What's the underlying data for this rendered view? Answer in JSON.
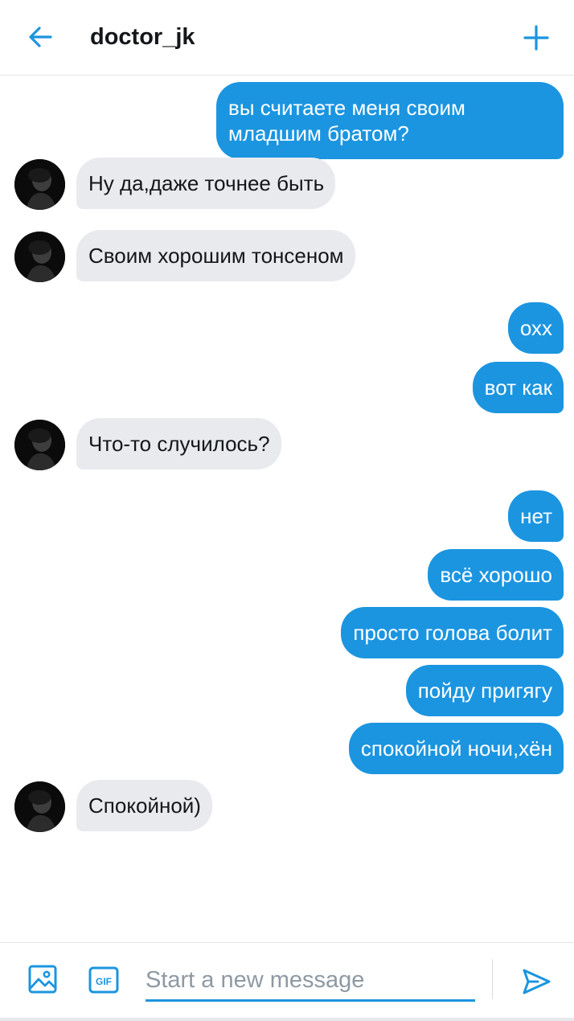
{
  "header": {
    "title": "doctor_jk",
    "back_icon": "arrow-left-icon",
    "new_icon": "plus-icon",
    "accent": "#1b95e0"
  },
  "messages": [
    {
      "from": "me",
      "text": "вы считаете меня своим\nмладшим братом?"
    },
    {
      "from": "them",
      "text": "Ну да,даже точнее быть"
    },
    {
      "from": "them",
      "text": "Своим хорошим тонсеном"
    },
    {
      "from": "me",
      "text": "охх"
    },
    {
      "from": "me",
      "text": "вот как"
    },
    {
      "from": "them",
      "text": "Что-то случилось?"
    },
    {
      "from": "me",
      "text": "нет"
    },
    {
      "from": "me",
      "text": "всё хорошо"
    },
    {
      "from": "me",
      "text": "просто голова болит"
    },
    {
      "from": "me",
      "text": "пойду пригягу"
    },
    {
      "from": "me",
      "text": "спокойной ночи,хён"
    },
    {
      "from": "them",
      "text": "Спокойной)"
    }
  ],
  "composer": {
    "placeholder": "Start a new message",
    "value": "",
    "image_icon": "image-icon",
    "gif_label": "GIF",
    "send_icon": "send-icon"
  },
  "colors": {
    "outgoing_bubble": "#1b95e0",
    "incoming_bubble": "#e8eaee",
    "placeholder": "#8e99a3"
  }
}
